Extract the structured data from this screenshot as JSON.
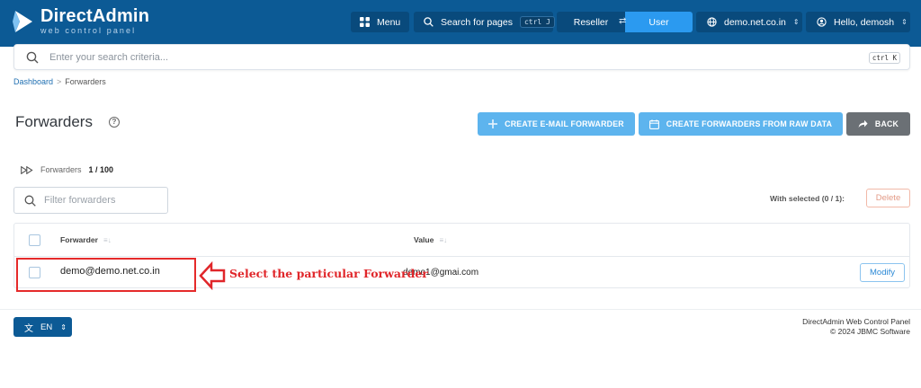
{
  "header": {
    "brand": {
      "title": "DirectAdmin",
      "subtitle": "web control panel"
    },
    "menu_label": "Menu",
    "search_pages_label": "Search for pages",
    "search_pages_shortcut": "ctrl J",
    "role_toggle": {
      "left": "Reseller",
      "right": "User",
      "active": "User"
    },
    "domain": "demo.net.co.in",
    "user_greeting": "Hello, demosh"
  },
  "global_search": {
    "placeholder": "Enter your search criteria...",
    "shortcut": "ctrl K"
  },
  "breadcrumb": {
    "items": [
      "Dashboard",
      "Forwarders"
    ]
  },
  "page": {
    "title": "Forwarders"
  },
  "actions": {
    "create_email_forwarder": "CREATE E-MAIL FORWARDER",
    "create_from_raw": "CREATE FORWARDERS FROM RAW DATA",
    "back": "BACK"
  },
  "summary": {
    "label": "Forwarders",
    "count": "1 / 100"
  },
  "filter": {
    "placeholder": "Filter forwarders"
  },
  "selection": {
    "label": "With selected (0 / 1):",
    "delete_label": "Delete"
  },
  "table": {
    "columns": [
      "Forwarder",
      "Value"
    ],
    "rows": [
      {
        "forwarder": "demo@demo.net.co.in",
        "value": "demo1@gmai.com",
        "action": "Modify"
      }
    ]
  },
  "annotation": {
    "text": "Select the particular Forwarder",
    "color": "#e0262a"
  },
  "language": {
    "code": "EN"
  },
  "footer": {
    "line1": "DirectAdmin Web Control Panel",
    "line2": "© 2024 JBMC Software"
  },
  "colors": {
    "header_bg": "#0c5a95",
    "primary": "#2b9af0",
    "action_btn": "#5db4ee",
    "back_btn": "#6b7075"
  }
}
